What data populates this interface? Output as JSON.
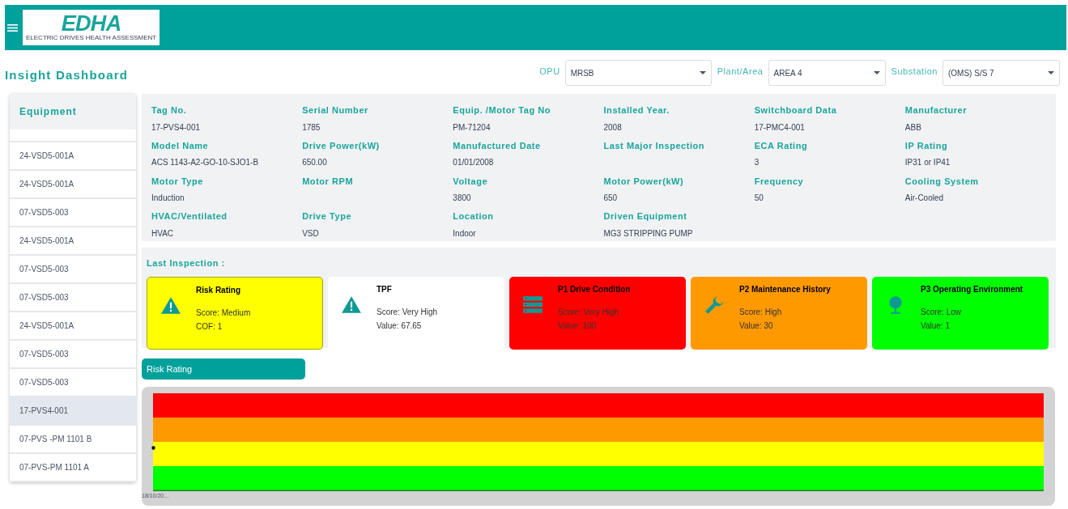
{
  "header": {
    "logo_title": "EDHA",
    "logo_subtitle": "ELECTRIC DRIVES HEALTH ASSESSMENT"
  },
  "page_title": "Insight Dashboard",
  "filters": [
    {
      "label": "OPU",
      "value": "MRSB"
    },
    {
      "label": "Plant/Area",
      "value": "AREA 4"
    },
    {
      "label": "Substation",
      "value": "(OMS) S/S 7"
    }
  ],
  "equipment_list": {
    "heading": "Equipment",
    "items": [
      {
        "label": "24-VSD5-001A",
        "selected": false
      },
      {
        "label": "24-VSD5-001A",
        "selected": false
      },
      {
        "label": "07-VSD5-003",
        "selected": false
      },
      {
        "label": "24-VSD5-001A",
        "selected": false
      },
      {
        "label": "07-VSD5-003",
        "selected": false
      },
      {
        "label": "07-VSD5-003",
        "selected": false
      },
      {
        "label": "24-VSD5-001A",
        "selected": false
      },
      {
        "label": "07-VSD5-003",
        "selected": false
      },
      {
        "label": "07-VSD5-003",
        "selected": false
      },
      {
        "label": "17-PVS4-001",
        "selected": true
      },
      {
        "label": "07-PVS -PM 1101 B",
        "selected": false
      },
      {
        "label": "07-PVS-PM 1101 A",
        "selected": false
      }
    ]
  },
  "details": [
    {
      "label": "Tag No.",
      "value": "17-PVS4-001"
    },
    {
      "label": "Serial Number",
      "value": "1785"
    },
    {
      "label": "Equip. /Motor Tag No",
      "value": "PM-71204"
    },
    {
      "label": "Installed Year.",
      "value": "2008"
    },
    {
      "label": "Switchboard Data",
      "value": "17-PMC4-001"
    },
    {
      "label": "Manufacturer",
      "value": "ABB"
    },
    {
      "label": "Model Name",
      "value": "ACS 1143-A2-GO-10-SJO1-B"
    },
    {
      "label": "Drive Power(kW)",
      "value": "650.00"
    },
    {
      "label": "Manufactured Date",
      "value": "01/01/2008"
    },
    {
      "label": "Last Major Inspection"
    },
    {
      "label": "ECA Rating",
      "value": "3"
    },
    {
      "label": "IP Rating",
      "value": "IP31 or IP41"
    },
    {
      "label": "Motor Type",
      "value": "Induction"
    },
    {
      "label": "Motor RPM"
    },
    {
      "label": "Voltage",
      "value": "3800"
    },
    {
      "label": "Motor Power(kW)",
      "value": "650"
    },
    {
      "label": "Frequency",
      "value": "50"
    },
    {
      "label": "Cooling System",
      "value": "Air-Cooled"
    },
    {
      "label": "HVAC/Ventilated",
      "value": "HVAC"
    },
    {
      "label": "Drive Type",
      "value": "VSD"
    },
    {
      "label": "Location",
      "value": "Indoor"
    },
    {
      "label": "Driven Equipment",
      "value": "MG3 STRIPPING PUMP"
    }
  ],
  "last_inspection": {
    "heading": "Last Inspection :",
    "cards": [
      {
        "kind": "warning",
        "title": "Risk Rating",
        "line_1": "Score: Medium",
        "line_2": "COF: 1",
        "color": "#ffff00",
        "selected": true
      },
      {
        "kind": "warning",
        "title": "TPF",
        "line_1": "Score: Very High",
        "line_2": "Value: 67.65",
        "color": "#ffffff",
        "selected": false
      },
      {
        "kind": "server",
        "title": "P1 Drive Condition",
        "line_1": "Score: Very High",
        "line_2": "Value: 100",
        "color": "#ff0000",
        "selected": false
      },
      {
        "kind": "wrench",
        "title": "P2 Maintenance History",
        "line_1": "Score: High",
        "line_2": "Value: 30",
        "color": "#ff9900",
        "selected": false
      },
      {
        "kind": "tree",
        "title": "P3 Operating Environment",
        "line_1": "Score: Low",
        "line_2": "Value: 1",
        "color": "#00ff00",
        "selected": false
      }
    ]
  },
  "chart_tab": "Risk Rating",
  "chart": {
    "x_tick": "18/10/20..."
  }
}
